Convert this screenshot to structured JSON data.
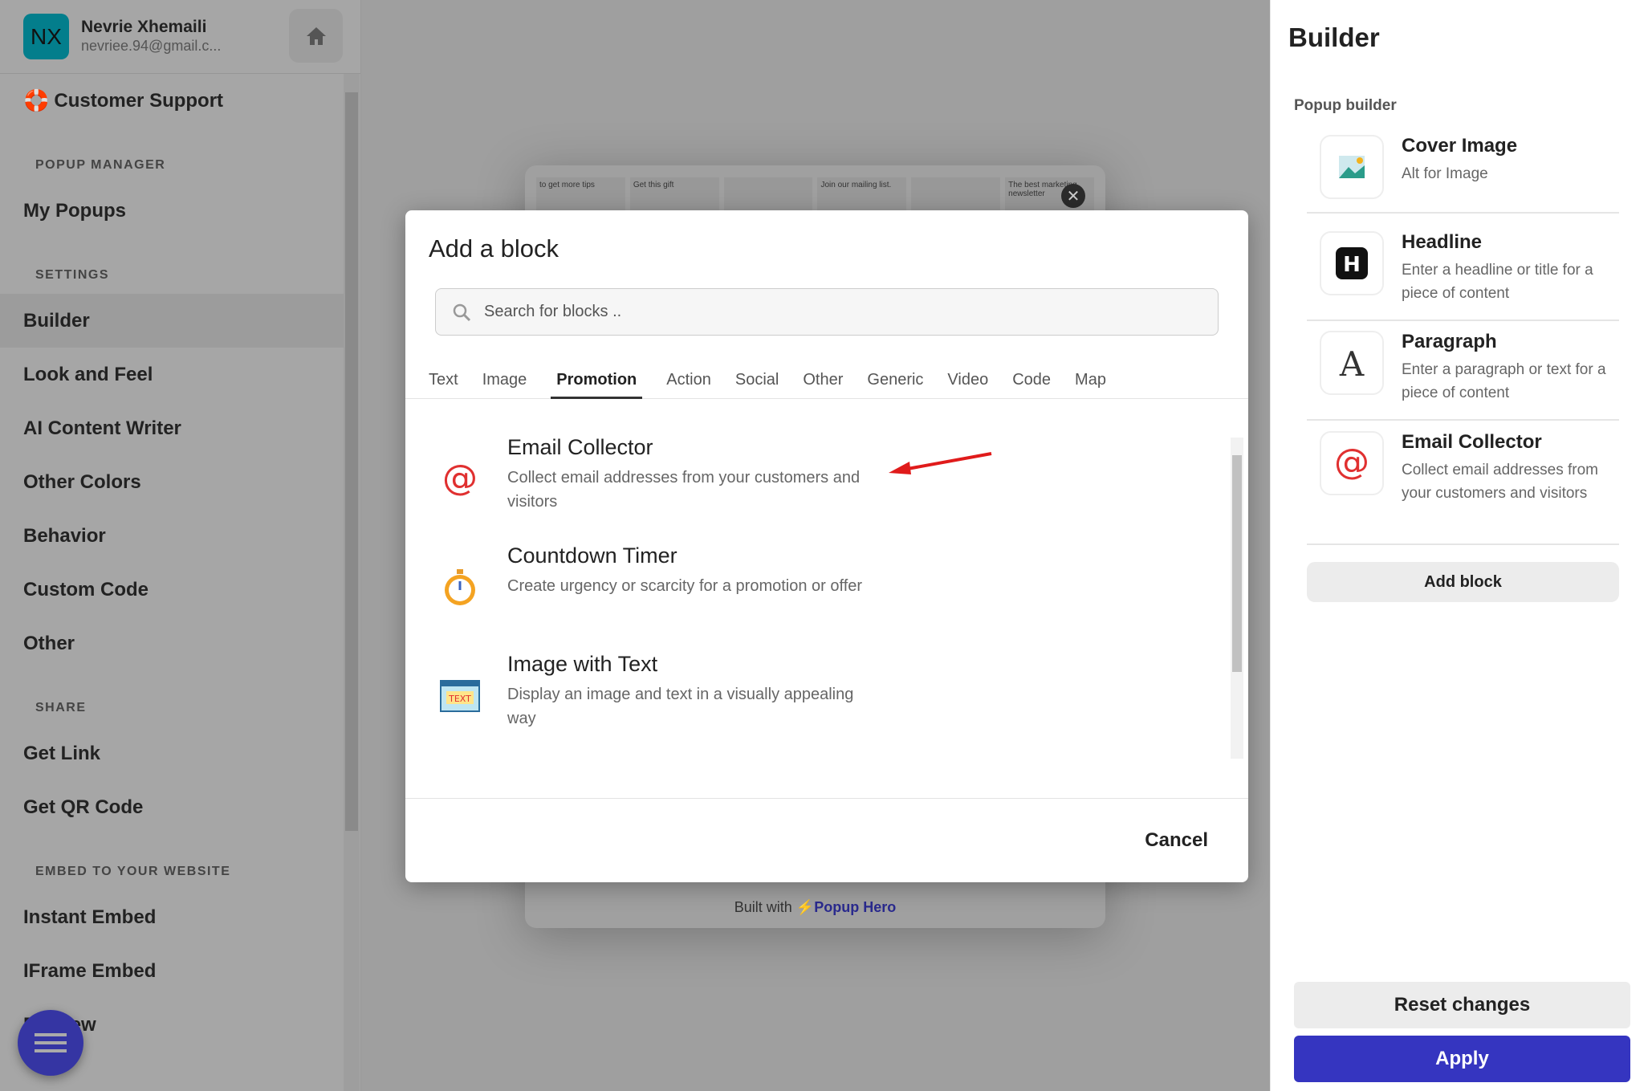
{
  "user": {
    "initials": "NX",
    "name": "Nevrie Xhemaili",
    "email": "nevriee.94@gmail.c..."
  },
  "sidebar": {
    "support": "Customer Support",
    "sections": [
      {
        "title": "POPUP MANAGER",
        "items": [
          "My Popups"
        ]
      },
      {
        "title": "SETTINGS",
        "items": [
          "Builder",
          "Look and Feel",
          "AI Content Writer",
          "Other Colors",
          "Behavior",
          "Custom Code",
          "Other"
        ]
      },
      {
        "title": "SHARE",
        "items": [
          "Get Link",
          "Get QR Code"
        ]
      },
      {
        "title": "EMBED TO YOUR WEBSITE",
        "items": [
          "Instant Embed",
          "IFrame Embed",
          "Preview"
        ]
      }
    ],
    "active": "Builder"
  },
  "preview": {
    "built_with": "Built with",
    "brand": "Popup Hero",
    "thumbs": [
      "to get more tips",
      "Get this gift",
      "",
      "Join our mailing list.",
      "",
      "The best marketing newsletter"
    ]
  },
  "modal": {
    "title": "Add a block",
    "search_placeholder": "Search for blocks ..",
    "tabs": [
      "Text",
      "Image",
      "Promotion",
      "Action",
      "Social",
      "Other",
      "Generic",
      "Video",
      "Code",
      "Map"
    ],
    "active_tab": "Promotion",
    "items": [
      {
        "title": "Email Collector",
        "desc": "Collect email addresses from your customers and visitors",
        "icon": "at-icon"
      },
      {
        "title": "Countdown Timer",
        "desc": "Create urgency or scarcity for a promotion or offer",
        "icon": "stopwatch-icon"
      },
      {
        "title": "Image with Text",
        "desc": "Display an image and text in a visually appealing way",
        "icon": "image-text-icon",
        "icon_text": "TEXT"
      }
    ],
    "cancel": "Cancel"
  },
  "builder": {
    "title": "Builder",
    "subtitle": "Popup builder",
    "items": [
      {
        "title": "Cover Image",
        "desc": "Alt for Image"
      },
      {
        "title": "Headline",
        "desc": "Enter a headline or title for a piece of content"
      },
      {
        "title": "Paragraph",
        "desc": "Enter a paragraph or text for a piece of content"
      },
      {
        "title": "Email Collector",
        "desc": "Collect email addresses from your customers and visitors"
      }
    ],
    "add_block": "Add block",
    "reset": "Reset changes",
    "apply": "Apply"
  },
  "colors": {
    "accent": "#3535c0",
    "avatar": "#037e8c",
    "arrow": "#e01b1b"
  }
}
